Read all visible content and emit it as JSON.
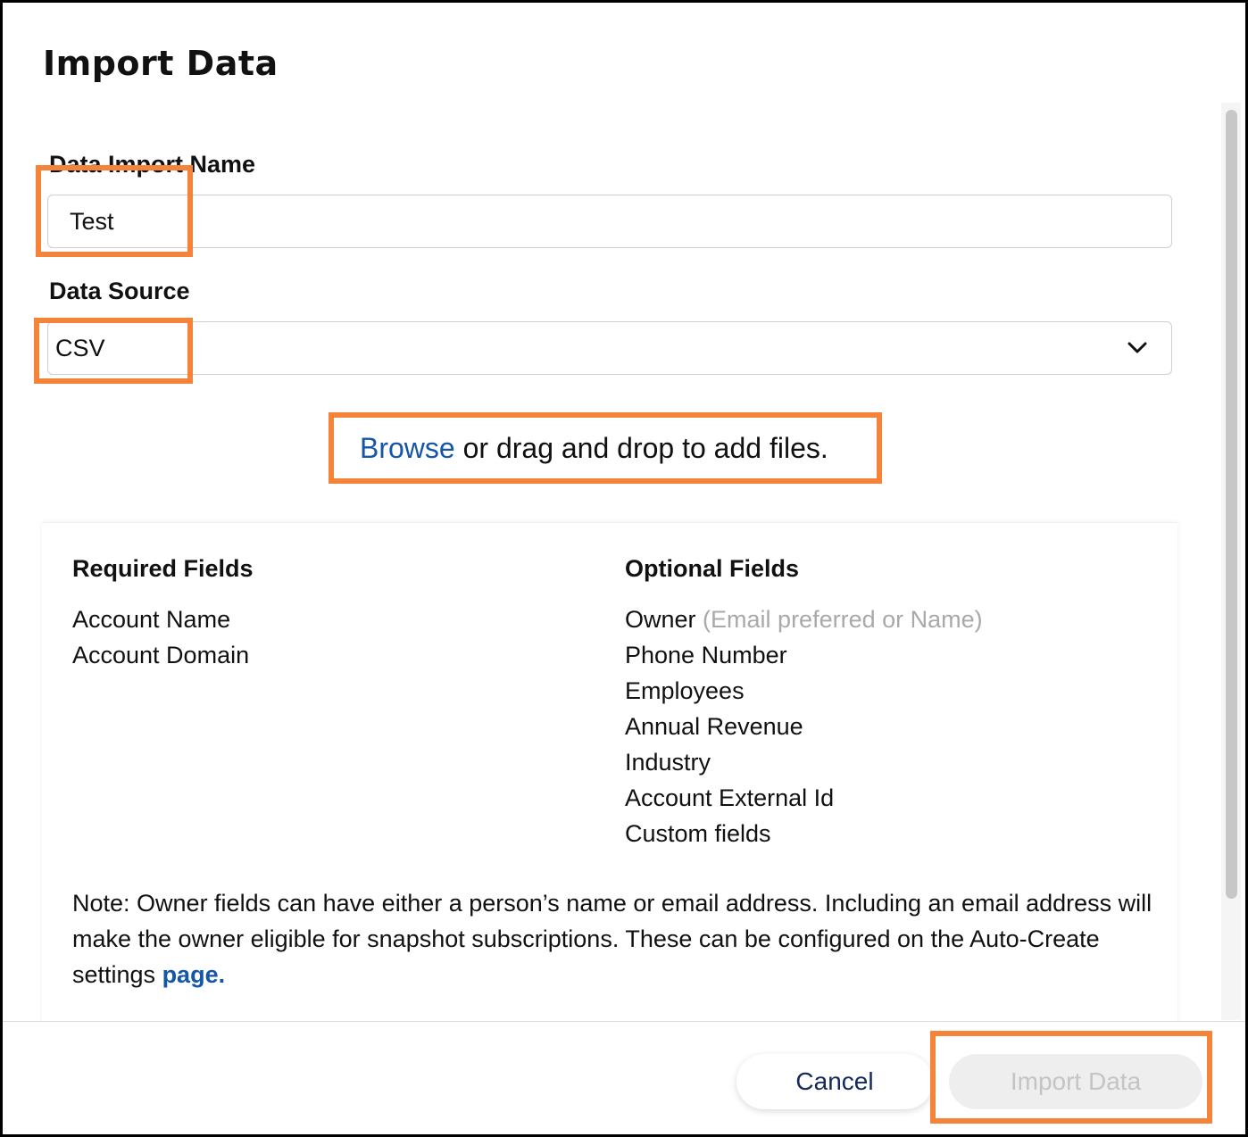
{
  "dialog": {
    "title": "Import Data"
  },
  "form": {
    "name_label": "Data Import Name",
    "name_value": "Test",
    "source_label": "Data Source",
    "source_value": "CSV"
  },
  "upload": {
    "browse_link": "Browse",
    "drop_text": " or drag and drop to add files."
  },
  "fields": {
    "required_heading": "Required Fields",
    "required": [
      "Account Name",
      "Account Domain"
    ],
    "optional_heading": "Optional Fields",
    "optional_owner": "Owner",
    "optional_owner_hint": "(Email preferred or Name)",
    "optional": [
      "Phone Number",
      "Employees",
      "Annual Revenue",
      "Industry",
      "Account External Id",
      "Custom fields"
    ],
    "note_text": "Note: Owner fields can have either a person’s name or email address. Including an email address will make the owner eligible for snapshot subscriptions. These can be configured on the Auto-Create settings ",
    "note_link": "page."
  },
  "footer": {
    "cancel_label": "Cancel",
    "import_label": "Import Data"
  },
  "colors": {
    "highlight": "#f5833a",
    "link": "#1456a8",
    "cancel_text": "#14285a"
  },
  "icons": {
    "source_dropdown": "chevron-down-icon"
  }
}
